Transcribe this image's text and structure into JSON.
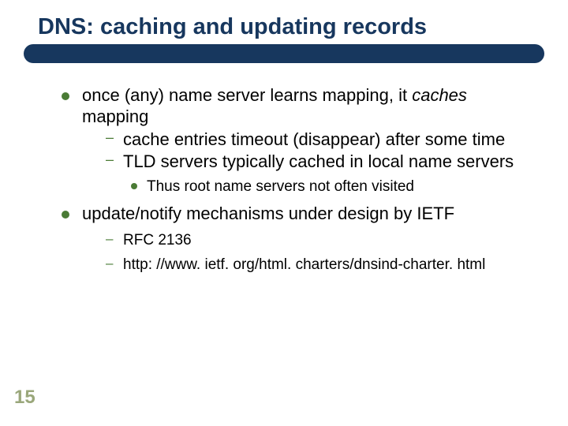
{
  "title": "DNS: caching and updating records",
  "b1": {
    "pre": "once (any) name server learns mapping, it ",
    "em": "caches",
    "post": " mapping",
    "sub1": "cache entries timeout (disappear) after some time",
    "sub2": "TLD servers typically cached in local name servers",
    "sub2a": "Thus root name servers not often visited"
  },
  "b2": {
    "text": "update/notify mechanisms under design by IETF",
    "sub1": "RFC 2136",
    "sub2": "http: //www. ietf. org/html. charters/dnsind-charter. html"
  },
  "slideNumber": "15"
}
